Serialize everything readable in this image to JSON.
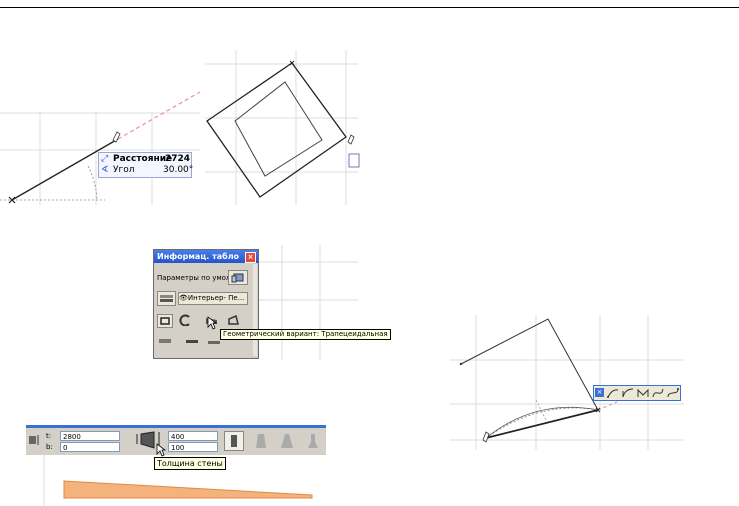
{
  "tracker": {
    "distance_label": "Расстояние",
    "distance_value": "2724",
    "angle_label": "Угол",
    "angle_value": "30.00°"
  },
  "info_palette": {
    "title": "Информац. табло",
    "default_params": "Параметры по умолч.",
    "layer": "Интерьер- Пе...",
    "tooltip": "Геометрический вариант: Трапецеидальная"
  },
  "wall_toolbar": {
    "top_label": "t:",
    "top_value": "2800",
    "bottom_label": "b:",
    "bottom_value": "0",
    "thickness_top": "400",
    "thickness_bottom": "100",
    "tooltip": "Толщина стены"
  },
  "colors": {
    "accent_blue": "#2555c8",
    "wall_fill": "#f4b37c",
    "palette_bg": "#d4d0c8",
    "tooltip_bg": "#ffffe1"
  }
}
